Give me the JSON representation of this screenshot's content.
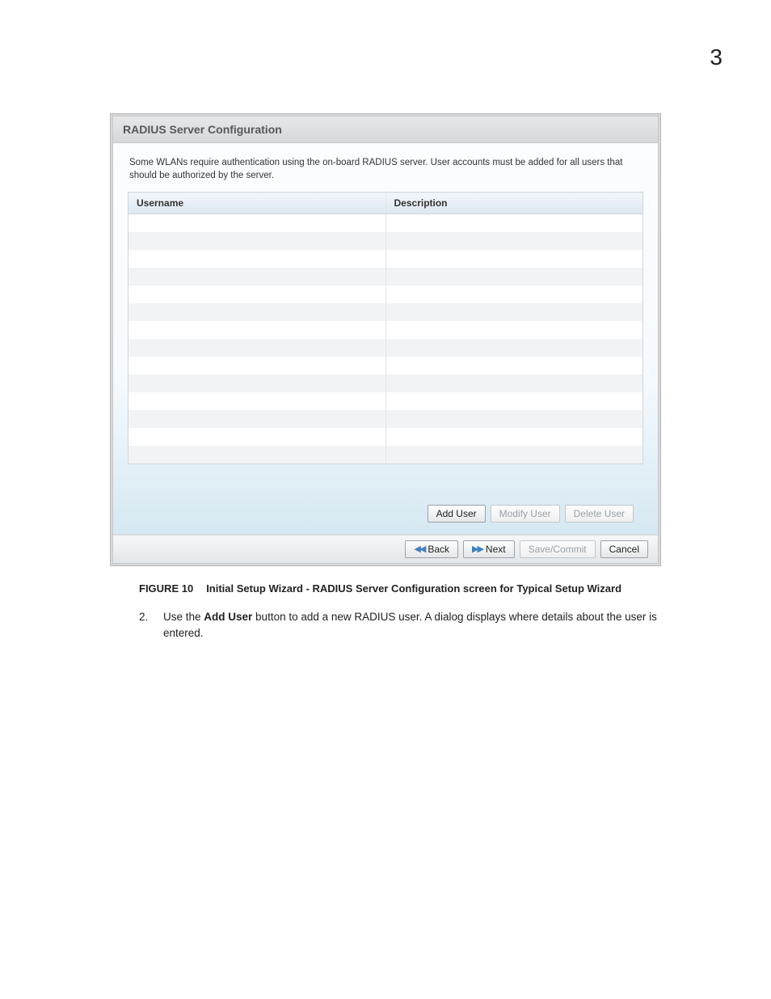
{
  "page_number": "3",
  "panel": {
    "title": "RADIUS Server Configuration",
    "intro": "Some WLANs require authentication using the on-board RADIUS server.  User accounts must be added for all users that should be authorized by the server.",
    "columns": {
      "username": "Username",
      "description": "Description"
    },
    "row_count": 14,
    "user_buttons": {
      "add": "Add User",
      "modify": "Modify User",
      "delete": "Delete User"
    }
  },
  "wizard": {
    "back": "Back",
    "next": "Next",
    "save": "Save/Commit",
    "cancel": "Cancel"
  },
  "caption": {
    "label": "FIGURE 10",
    "text": "Initial Setup Wizard - RADIUS Server Configuration screen for Typical Setup Wizard"
  },
  "step": {
    "number": "2.",
    "pre": "Use the ",
    "bold": "Add User",
    "post": " button to add a new RADIUS user. A dialog displays where details about the user is entered."
  }
}
